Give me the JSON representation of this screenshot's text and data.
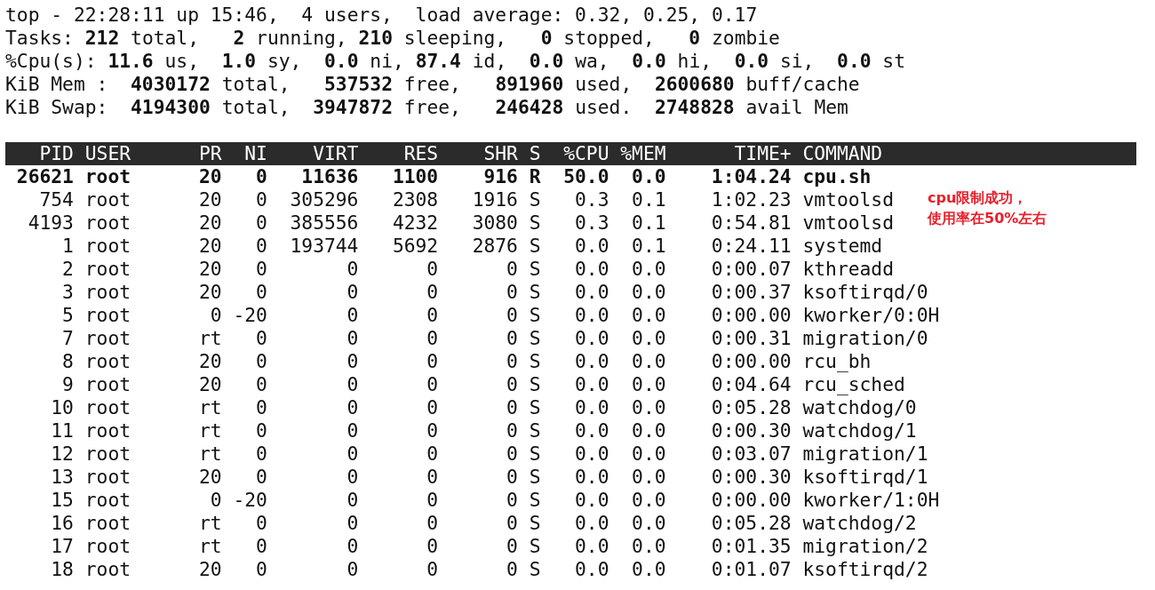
{
  "summary_lines": [
    "top - 22:28:11 up 15:46,  4 users,  load average: 0.32, 0.25, 0.17",
    "Tasks: **212** total,   **2** running, **210** sleeping,   **0** stopped,   **0** zombie",
    "%Cpu(s): **11.6** us,  **1.0** sy,  **0.0** ni, **87.4** id,  **0.0** wa,  **0.0** hi,  **0.0** si,  **0.0** st",
    "KiB Mem :  **4030172** total,   **537532** free,   **891960** used,  **2600680** buff/cache",
    "KiB Swap:  **4194300** total,  **3947872** free,   **246428** used.  **2748828** avail Mem"
  ],
  "table": {
    "columns": [
      "PID",
      "USER",
      "PR",
      "NI",
      "VIRT",
      "RES",
      "SHR",
      "S",
      "%CPU",
      "%MEM",
      "TIME+",
      "COMMAND"
    ],
    "rows": [
      {
        "highlighted": true,
        "cells": [
          "26621",
          "root",
          "20",
          "0",
          "11636",
          "1100",
          "916",
          "R",
          "50.0",
          "0.0",
          "1:04.24",
          "cpu.sh"
        ]
      },
      {
        "highlighted": false,
        "cells": [
          "754",
          "root",
          "20",
          "0",
          "305296",
          "2308",
          "1916",
          "S",
          "0.3",
          "0.1",
          "1:02.23",
          "vmtoolsd"
        ]
      },
      {
        "highlighted": false,
        "cells": [
          "4193",
          "root",
          "20",
          "0",
          "385556",
          "4232",
          "3080",
          "S",
          "0.3",
          "0.1",
          "0:54.81",
          "vmtoolsd"
        ]
      },
      {
        "highlighted": false,
        "cells": [
          "1",
          "root",
          "20",
          "0",
          "193744",
          "5692",
          "2876",
          "S",
          "0.0",
          "0.1",
          "0:24.11",
          "systemd"
        ]
      },
      {
        "highlighted": false,
        "cells": [
          "2",
          "root",
          "20",
          "0",
          "0",
          "0",
          "0",
          "S",
          "0.0",
          "0.0",
          "0:00.07",
          "kthreadd"
        ]
      },
      {
        "highlighted": false,
        "cells": [
          "3",
          "root",
          "20",
          "0",
          "0",
          "0",
          "0",
          "S",
          "0.0",
          "0.0",
          "0:00.37",
          "ksoftirqd/0"
        ]
      },
      {
        "highlighted": false,
        "cells": [
          "5",
          "root",
          "0",
          "-20",
          "0",
          "0",
          "0",
          "S",
          "0.0",
          "0.0",
          "0:00.00",
          "kworker/0:0H"
        ]
      },
      {
        "highlighted": false,
        "cells": [
          "7",
          "root",
          "rt",
          "0",
          "0",
          "0",
          "0",
          "S",
          "0.0",
          "0.0",
          "0:00.31",
          "migration/0"
        ]
      },
      {
        "highlighted": false,
        "cells": [
          "8",
          "root",
          "20",
          "0",
          "0",
          "0",
          "0",
          "S",
          "0.0",
          "0.0",
          "0:00.00",
          "rcu_bh"
        ]
      },
      {
        "highlighted": false,
        "cells": [
          "9",
          "root",
          "20",
          "0",
          "0",
          "0",
          "0",
          "S",
          "0.0",
          "0.0",
          "0:04.64",
          "rcu_sched"
        ]
      },
      {
        "highlighted": false,
        "cells": [
          "10",
          "root",
          "rt",
          "0",
          "0",
          "0",
          "0",
          "S",
          "0.0",
          "0.0",
          "0:05.28",
          "watchdog/0"
        ]
      },
      {
        "highlighted": false,
        "cells": [
          "11",
          "root",
          "rt",
          "0",
          "0",
          "0",
          "0",
          "S",
          "0.0",
          "0.0",
          "0:00.30",
          "watchdog/1"
        ]
      },
      {
        "highlighted": false,
        "cells": [
          "12",
          "root",
          "rt",
          "0",
          "0",
          "0",
          "0",
          "S",
          "0.0",
          "0.0",
          "0:03.07",
          "migration/1"
        ]
      },
      {
        "highlighted": false,
        "cells": [
          "13",
          "root",
          "20",
          "0",
          "0",
          "0",
          "0",
          "S",
          "0.0",
          "0.0",
          "0:00.30",
          "ksoftirqd/1"
        ]
      },
      {
        "highlighted": false,
        "cells": [
          "15",
          "root",
          "0",
          "-20",
          "0",
          "0",
          "0",
          "S",
          "0.0",
          "0.0",
          "0:00.00",
          "kworker/1:0H"
        ]
      },
      {
        "highlighted": false,
        "cells": [
          "16",
          "root",
          "rt",
          "0",
          "0",
          "0",
          "0",
          "S",
          "0.0",
          "0.0",
          "0:05.28",
          "watchdog/2"
        ]
      },
      {
        "highlighted": false,
        "cells": [
          "17",
          "root",
          "rt",
          "0",
          "0",
          "0",
          "0",
          "S",
          "0.0",
          "0.0",
          "0:01.35",
          "migration/2"
        ]
      },
      {
        "highlighted": false,
        "cells": [
          "18",
          "root",
          "20",
          "0",
          "0",
          "0",
          "0",
          "S",
          "0.0",
          "0.0",
          "0:01.07",
          "ksoftirqd/2"
        ]
      }
    ]
  },
  "annotation": {
    "lines": [
      "cpu限制成功，",
      "使用率在50%左右"
    ]
  }
}
